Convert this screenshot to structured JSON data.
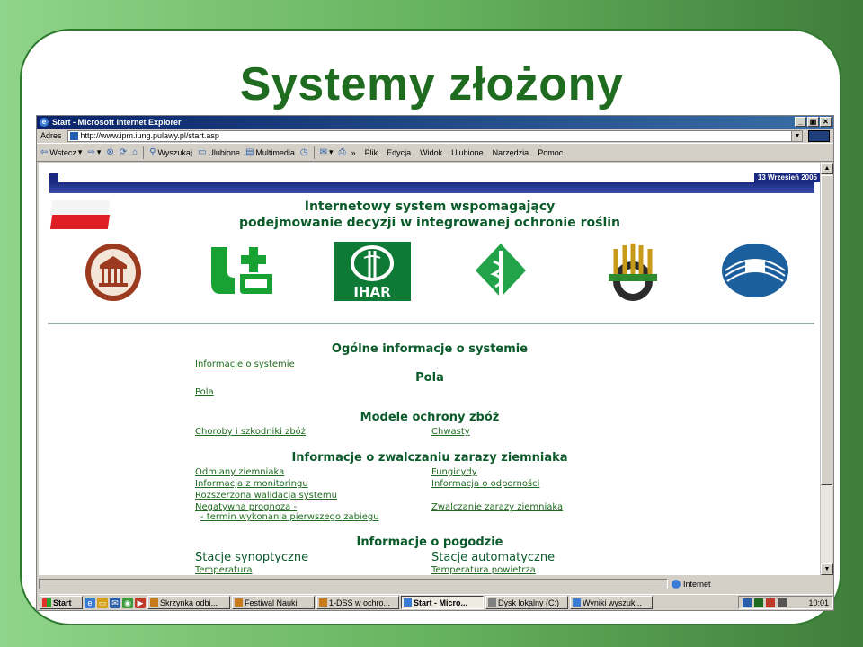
{
  "slide": {
    "title": "Systemy złożony"
  },
  "window": {
    "title": "Start - Microsoft Internet Explorer",
    "minimize": "_",
    "maximize": "▣",
    "close": "✕"
  },
  "address": {
    "label": "Adres",
    "url": "http://www.ipm.iung.pulawy.pl/start.asp"
  },
  "toolbar": {
    "back": "Wstecz",
    "search": "Wyszukaj",
    "favorites": "Ulubione",
    "multimedia": "Multimedia",
    "menu": [
      "Plik",
      "Edycja",
      "Widok",
      "Ulubione",
      "Narzędzia",
      "Pomoc"
    ]
  },
  "page": {
    "date": "13 Wrzesień 2005",
    "headline_1": "Internetowy system wspomagający",
    "headline_2": "podejmowanie decyzji w integrowanej ochronie roślin",
    "logos": [
      "IUNG",
      "Cross",
      "IHAR",
      "Caduceus",
      "WODR",
      "IGS"
    ],
    "ihar_text": "IHAR",
    "sections": {
      "general": "Ogólne informacje o systemie",
      "general_link": "Informacje o systemie",
      "fields": "Pola",
      "fields_link": "Pola",
      "cereal_models": "Modele ochrony zbóż",
      "cereal_links": [
        "Choroby i szkodniki zbóż",
        "Chwasty"
      ],
      "potato": "Informacje o zwalczaniu zarazy ziemniaka",
      "potato_left": [
        "Odmiany ziemniaka",
        "Informacja z monitoringu",
        "Rozszerzona walidacja systemu",
        "Negatywna prognoza -"
      ],
      "potato_left_extra": "- termin wykonania pierwszego zabiegu",
      "potato_right": [
        "Fungicydy",
        "Informacja o odporności",
        "Zwalczanie zarazy ziemniaka"
      ],
      "weather": "Informacje o pogodzie",
      "synoptic": "Stacje synoptyczne",
      "automatic": "Stacje automatyczne",
      "temp_link": "Temperatura",
      "air_temp_link": "Temperatura powietrza"
    }
  },
  "status": {
    "zone": "Internet"
  },
  "taskbar": {
    "start": "Start",
    "tasks": [
      "Skrzynka odbi...",
      "Festiwal Nauki",
      "1-DSS w ochro...",
      "Start - Micro...",
      "Dysk lokalny (C:)",
      "Wyniki wyszuk..."
    ],
    "time": "10:01"
  },
  "colors": {
    "link": "#1f6b1f",
    "heading": "#0a5a2a",
    "band": "#1a2a80",
    "title_green": "#1f6b1f"
  }
}
